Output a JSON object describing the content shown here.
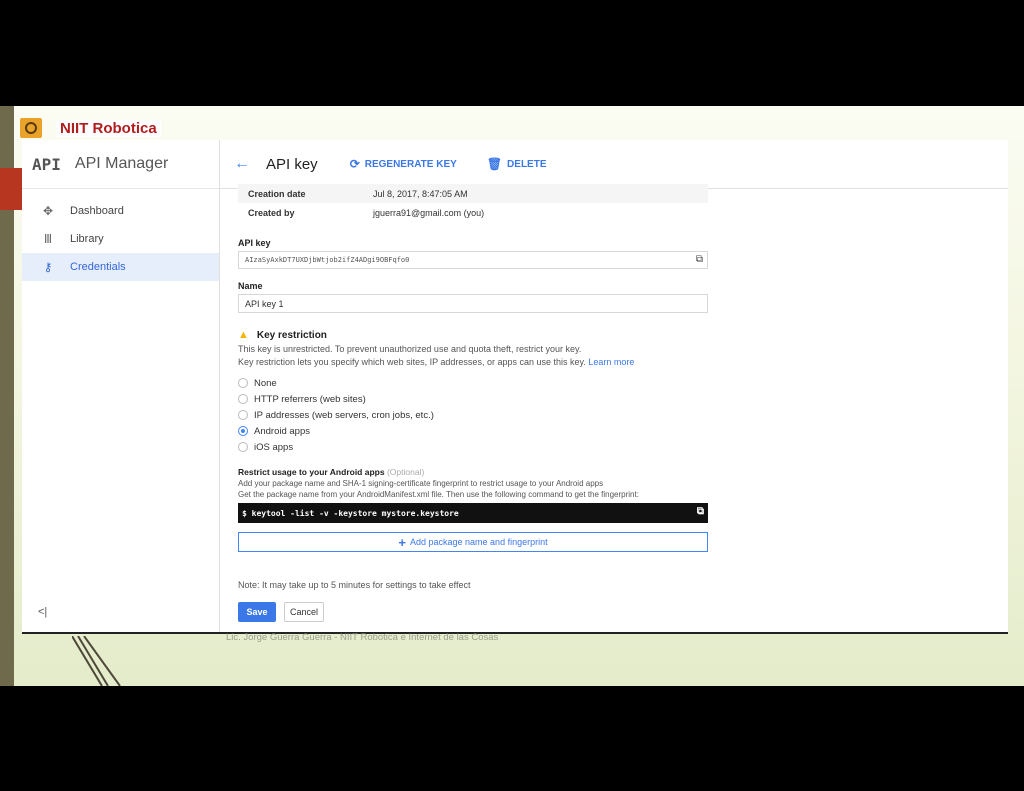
{
  "slide": {
    "brand": "NIIT Robotica",
    "footer": "Lic. Jorge Guerra Guerra - NIIT Robotica e Internet de las Cosas"
  },
  "sidebar": {
    "logo": "API",
    "title": "API Manager",
    "items": [
      {
        "icon": "dashboard-icon",
        "label": "Dashboard",
        "active": false
      },
      {
        "icon": "library-icon",
        "label": "Library",
        "active": false
      },
      {
        "icon": "key-icon",
        "label": "Credentials",
        "active": true
      }
    ],
    "collapse": "<|"
  },
  "toolbar": {
    "title": "API key",
    "regenerate": "REGENERATE KEY",
    "delete": "DELETE"
  },
  "meta": [
    {
      "key": "Creation date",
      "value": "Jul 8, 2017, 8:47:05 AM"
    },
    {
      "key": "Created by",
      "value": "jguerra91@gmail.com (you)"
    }
  ],
  "api_key": {
    "label": "API key",
    "value": "AIzaSyAxkDT7UXDjbWtjob2ifZ4ADgi9OBFqfo0"
  },
  "name": {
    "label": "Name",
    "value": "API key 1"
  },
  "restriction": {
    "title": "Key restriction",
    "line1": "This key is unrestricted. To prevent unauthorized use and quota theft, restrict your key.",
    "line2": "Key restriction lets you specify which web sites, IP addresses, or apps can use this key.",
    "learn_more": "Learn more",
    "options": [
      {
        "label": "None",
        "selected": false
      },
      {
        "label": "HTTP referrers (web sites)",
        "selected": false
      },
      {
        "label": "IP addresses (web servers, cron jobs, etc.)",
        "selected": false
      },
      {
        "label": "Android apps",
        "selected": true
      },
      {
        "label": "iOS apps",
        "selected": false
      }
    ]
  },
  "android": {
    "title": "Restrict usage to your Android apps",
    "optional": "(Optional)",
    "line1": "Add your package name and SHA-1 signing-certificate fingerprint to restrict usage to your Android apps",
    "line2": "Get the package name from your AndroidManifest.xml file. Then use the following command to get the fingerprint:",
    "command": "$ keytool -list -v -keystore mystore.keystore",
    "add_button": "Add package name and fingerprint"
  },
  "note": "Note: It may take up to 5 minutes for settings to take effect",
  "actions": {
    "save": "Save",
    "cancel": "Cancel"
  }
}
